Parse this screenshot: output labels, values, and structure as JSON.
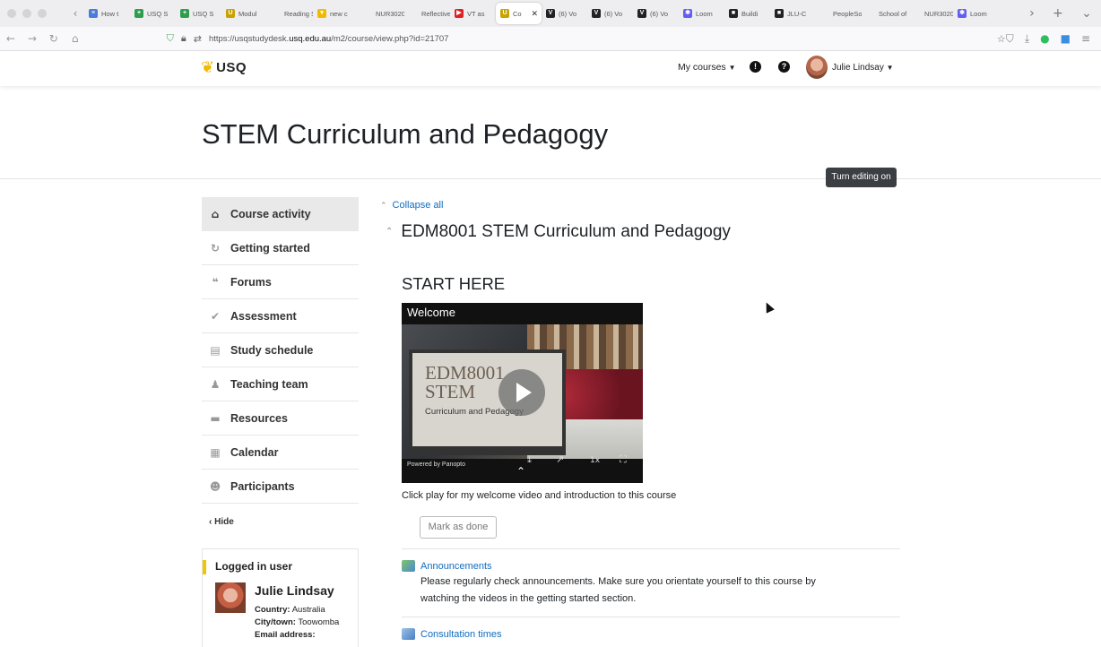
{
  "browser": {
    "tabs": [
      {
        "label": "How t",
        "fav_color": "#4a7bd8",
        "fav_char": "≡"
      },
      {
        "label": "USQ S",
        "fav_color": "#2e9e4e",
        "fav_char": "+"
      },
      {
        "label": "USQ S",
        "fav_color": "#2e9e4e",
        "fav_char": "+"
      },
      {
        "label": "Modul",
        "fav_color": "#c7a200",
        "fav_char": "U"
      },
      {
        "label": "Reading S",
        "fav_color": "#eeeef0",
        "fav_char": ""
      },
      {
        "label": "new c",
        "fav_color": "#f2b900",
        "fav_char": "▾"
      },
      {
        "label": "NUR3020",
        "fav_color": "#eeeef0",
        "fav_char": ""
      },
      {
        "label": "Reflective",
        "fav_color": "#eeeef0",
        "fav_char": ""
      },
      {
        "label": "VT as",
        "fav_color": "#e02020",
        "fav_char": "▶"
      },
      {
        "label": "Co",
        "fav_color": "#c7a200",
        "fav_char": "U"
      },
      {
        "label": "(6) Vo",
        "fav_color": "#222222",
        "fav_char": "V"
      },
      {
        "label": "(6) Vo",
        "fav_color": "#222222",
        "fav_char": "V"
      },
      {
        "label": "(6) Vo",
        "fav_color": "#222222",
        "fav_char": "V"
      },
      {
        "label": "Loom",
        "fav_color": "#625df5",
        "fav_char": "✱"
      },
      {
        "label": "Buildi",
        "fav_color": "#222222",
        "fav_char": "■"
      },
      {
        "label": "JLU-C",
        "fav_color": "#222222",
        "fav_char": "■"
      },
      {
        "label": "PeopleSof",
        "fav_color": "#eeeef0",
        "fav_char": ""
      },
      {
        "label": "School of",
        "fav_color": "#eeeef0",
        "fav_char": ""
      },
      {
        "label": "NUR3020",
        "fav_color": "#eeeef0",
        "fav_char": ""
      },
      {
        "label": "Loom",
        "fav_color": "#625df5",
        "fav_char": "✱"
      }
    ],
    "active_tab_index": 9,
    "url_prefix": "https://usqstudydesk.",
    "url_domain": "usq.edu.au",
    "url_suffix": "/m2/course/view.php?id=21707"
  },
  "navbar": {
    "logo_text": "USQ",
    "my_courses": "My courses",
    "notification_icon": "!",
    "help_icon": "?",
    "user_name": "Julie Lindsay"
  },
  "header": {
    "title": "STEM Curriculum and Pedagogy",
    "edit_button": "Turn editing on"
  },
  "course_index": {
    "items": [
      {
        "label": "Course activity",
        "icon": "⌂"
      },
      {
        "label": "Getting started",
        "icon": "↻"
      },
      {
        "label": "Forums",
        "icon": "❝"
      },
      {
        "label": "Assessment",
        "icon": "✔"
      },
      {
        "label": "Study schedule",
        "icon": "▤"
      },
      {
        "label": "Teaching team",
        "icon": "♟"
      },
      {
        "label": "Resources",
        "icon": "▬"
      },
      {
        "label": "Calendar",
        "icon": "▦"
      },
      {
        "label": "Participants",
        "icon": "☻"
      }
    ],
    "hide_label": "Hide"
  },
  "logged_in": {
    "title": "Logged in user",
    "name": "Julie Lindsay",
    "country_label": "Country:",
    "country": "Australia",
    "city_label": "City/town:",
    "city": "Toowomba",
    "email_label": "Email address:"
  },
  "main": {
    "collapse_all": "Collapse all",
    "section_title": "EDM8001 STEM Curriculum and Pedagogy",
    "start_here": "START HERE",
    "video": {
      "title": "Welcome",
      "slide_line1": "EDM8001",
      "slide_line2": "STEM",
      "slide_line3": "Curriculum and Pedagogy",
      "powered_by": "Powered by Panopto",
      "speed": "1x"
    },
    "video_caption": "Click play for my welcome video and introduction to this course",
    "mark_done": "Mark as done",
    "announcements_label": "Announcements",
    "announcements_desc": "Please regularly check announcements. Make sure you orientate yourself to this course by watching the videos in the getting started section.",
    "consultation_label": "Consultation times"
  }
}
